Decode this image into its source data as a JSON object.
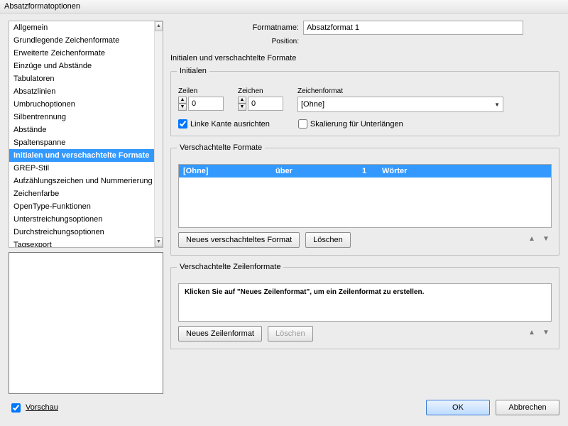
{
  "window": {
    "title": "Absatzformatoptionen"
  },
  "sidebar": {
    "items": [
      "Allgemein",
      "Grundlegende Zeichenformate",
      "Erweiterte Zeichenformate",
      "Einzüge und Abstände",
      "Tabulatoren",
      "Absatzlinien",
      "Umbruchoptionen",
      "Silbentrennung",
      "Abstände",
      "Spaltenspanne",
      "Initialen und verschachtelte Formate",
      "GREP-Stil",
      "Aufzählungszeichen und Nummerierung",
      "Zeichenfarbe",
      "OpenType-Funktionen",
      "Unterstreichungsoptionen",
      "Durchstreichungsoptionen",
      "Tagsexport"
    ],
    "selected_index": 10
  },
  "header": {
    "formatname_label": "Formatname:",
    "formatname_value": "Absatzformat 1",
    "position_label": "Position:",
    "section_heading": "Initialen und verschachtelte Formate"
  },
  "initialen": {
    "group_title": "Initialen",
    "zeilen_label": "Zeilen",
    "zeilen_value": "0",
    "zeichen_label": "Zeichen",
    "zeichen_value": "0",
    "zeichenformat_label": "Zeichenformat",
    "zeichenformat_value": "[Ohne]",
    "align_left_label": "Linke Kante ausrichten",
    "align_left_checked": true,
    "scale_label": "Skalierung für Unterlängen",
    "scale_checked": false
  },
  "nested_formats": {
    "group_title": "Verschachtelte Formate",
    "row": {
      "c1": "[Ohne]",
      "c2": "über",
      "c3": "1",
      "c4": "Wörter"
    },
    "new_btn": "Neues verschachteltes Format",
    "delete_btn": "Löschen"
  },
  "line_formats": {
    "group_title": "Verschachtelte Zeilenformate",
    "hint": "Klicken Sie auf \"Neues Zeilenformat\", um ein Zeilenformat zu erstellen.",
    "new_btn": "Neues Zeilenformat",
    "delete_btn": "Löschen"
  },
  "footer": {
    "preview_label": "Vorschau",
    "preview_checked": true,
    "ok": "OK",
    "cancel": "Abbrechen"
  }
}
